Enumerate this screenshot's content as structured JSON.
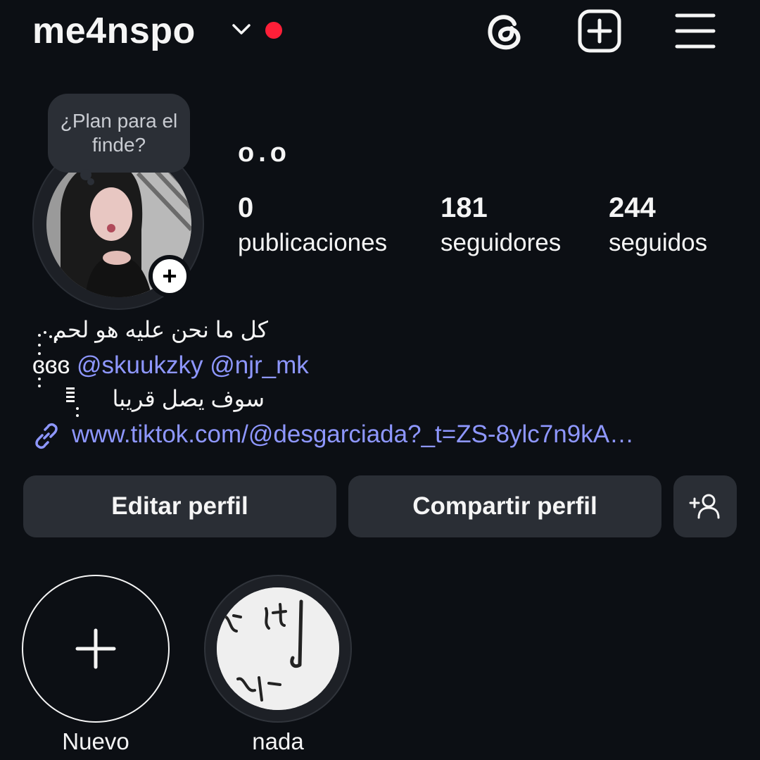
{
  "header": {
    "username": "me4nspo",
    "icons": [
      "threads-icon",
      "add-post-icon",
      "menu-icon"
    ]
  },
  "profile": {
    "note": "¿Plan para el finde?",
    "display_name": "o.o",
    "stats": {
      "posts_count": "0",
      "posts_label": "publicaciones",
      "followers_count": "181",
      "followers_label": "seguidores",
      "following_count": "244",
      "following_label": "seguidos"
    },
    "bio": {
      "line1": "كل ما نحن عليه هو لحم",
      "line2_prefix": "ɞɞɞ ",
      "mention1": "@skuukzky",
      "mention2": "@njr_mk",
      "line3": "سوف يصل قريبا",
      "link": "www.tiktok.com/@desgarciada?_t=ZS-8ylc7n9kA…"
    }
  },
  "actions": {
    "edit_label": "Editar perfil",
    "share_label": "Compartir perfil"
  },
  "highlights": [
    {
      "label": "Nuevo"
    },
    {
      "label": "nada"
    }
  ],
  "colors": {
    "background": "#0c0f14",
    "accent_link": "#8e97ff",
    "button_bg": "#2a2e35",
    "notification_dot": "#ff1f38"
  }
}
